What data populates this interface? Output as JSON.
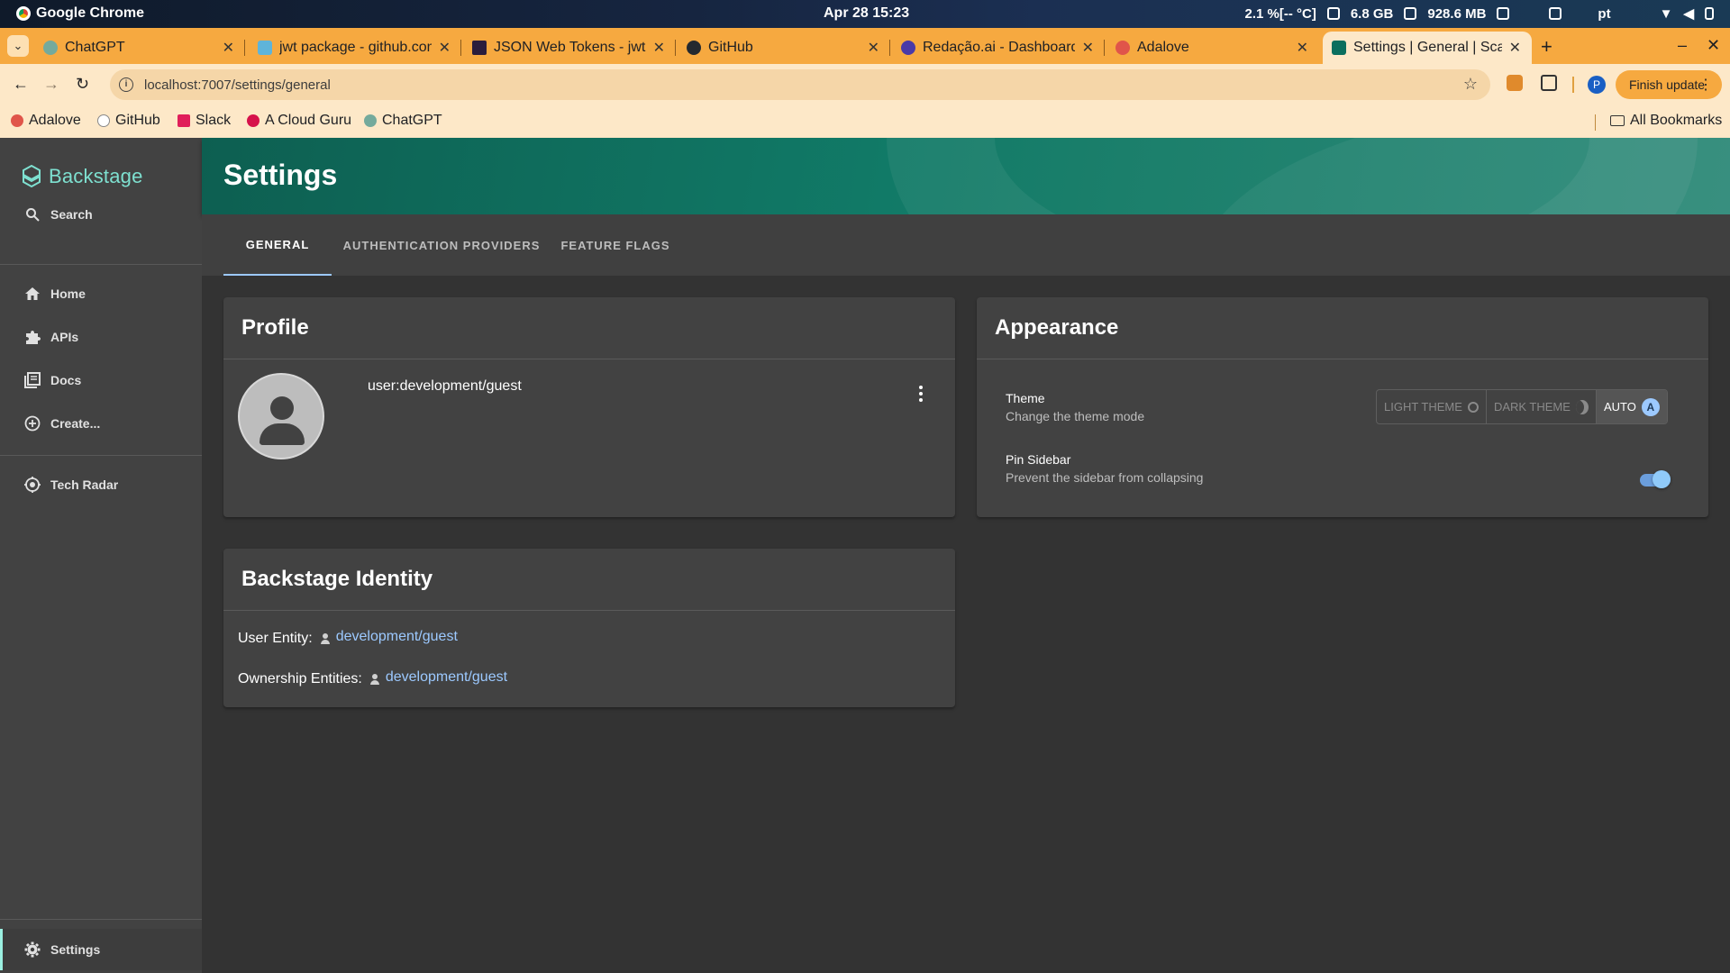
{
  "os": {
    "app_name": "Google Chrome",
    "clock": "Apr 28  15:23",
    "cpu": "2.1 %[-- °C]",
    "mem": "6.8 GB",
    "swap": "928.6 MB",
    "lang": "pt"
  },
  "browser": {
    "tabs": [
      {
        "title": "ChatGPT",
        "favicon_color": "#74aa9c"
      },
      {
        "title": "jwt package - github.com",
        "favicon_color": "#5fb4d9"
      },
      {
        "title": "JSON Web Tokens - jwt.io",
        "favicon_color": "#2b1d3c"
      },
      {
        "title": "GitHub",
        "favicon_color": "#24292f"
      },
      {
        "title": "Redação.ai - Dashboard",
        "favicon_color": "#4a3aa8"
      },
      {
        "title": "Adalove",
        "favicon_color": "#e0554a"
      },
      {
        "title": "Settings | General | Scaffolded Backstage App",
        "favicon_color": "#0b6f5e"
      }
    ],
    "url": "localhost:7007/settings/general",
    "finish_update": "Finish update",
    "profile_initial": "P",
    "bookmarks": [
      {
        "label": "Adalove",
        "color": "#e0554a"
      },
      {
        "label": "GitHub",
        "color": "#ffffff"
      },
      {
        "label": "Slack",
        "color": "#e01e5a"
      },
      {
        "label": "A Cloud Guru",
        "color": "#d6124b"
      },
      {
        "label": "ChatGPT",
        "color": "#74aa9c"
      }
    ],
    "all_bookmarks": "All Bookmarks"
  },
  "sidebar": {
    "logo": "Backstage",
    "search": "Search",
    "items": [
      {
        "label": "Home",
        "icon": "home-icon"
      },
      {
        "label": "APIs",
        "icon": "puzzle-icon"
      },
      {
        "label": "Docs",
        "icon": "library-icon"
      },
      {
        "label": "Create...",
        "icon": "add-circle-icon"
      }
    ],
    "tech_radar": "Tech Radar",
    "settings": "Settings"
  },
  "header": {
    "title": "Settings"
  },
  "tabs": [
    {
      "label": "GENERAL",
      "active": true
    },
    {
      "label": "AUTHENTICATION PROVIDERS",
      "active": false
    },
    {
      "label": "FEATURE FLAGS",
      "active": false
    }
  ],
  "profile": {
    "title": "Profile",
    "user": "user:development/guest"
  },
  "appearance": {
    "title": "Appearance",
    "theme_title": "Theme",
    "theme_desc": "Change the theme mode",
    "theme_options": [
      "LIGHT THEME",
      "DARK THEME",
      "AUTO"
    ],
    "theme_selected": "AUTO",
    "pin_title": "Pin Sidebar",
    "pin_desc": "Prevent the sidebar from collapsing",
    "pin_enabled": true
  },
  "identity": {
    "title": "Backstage Identity",
    "user_entity_label": "User Entity:",
    "user_entity": "development/guest",
    "ownership_label": "Ownership Entities:",
    "ownership_entity": "development/guest"
  },
  "colors": {
    "accent": "#9cc9ff",
    "header": "#117a67",
    "logo": "#7ee0d0"
  }
}
